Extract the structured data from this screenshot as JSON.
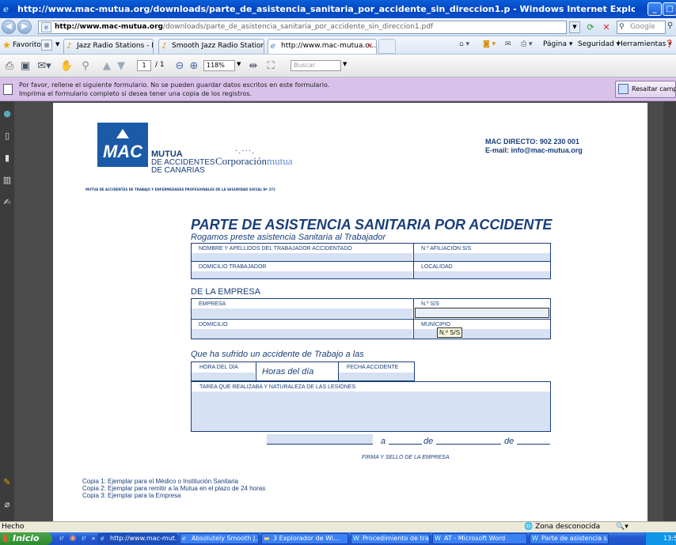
{
  "window": {
    "title": "http://www.mac-mutua.org/downloads/parte_de_asistencia_sanitaria_por_accidente_sin_direccion1.p - Windows Internet Explorer"
  },
  "nav": {
    "address_domain": "http://www.mac-mutua.org",
    "address_path": "/downloads/parte_de_asistencia_sanitaria_por_accidente_sin_direccion1.pdf",
    "search_placeholder": "Google"
  },
  "favorites": {
    "label": "Favoritos",
    "tabs": [
      {
        "label": "Jazz Radio Stations - Free In..."
      },
      {
        "label": "Smooth Jazz Radio Stations -..."
      },
      {
        "label": "http://www.mac-mutua.o..."
      }
    ],
    "commands": {
      "page": "Página",
      "security": "Seguridad",
      "tools": "Herramientas"
    }
  },
  "pdf_toolbar": {
    "page_current": "1",
    "page_total": "/ 1",
    "zoom": "118%",
    "search_placeholder": "Buscar"
  },
  "form_notice": {
    "line1": "Por favor, rellene el siguiente formulario. No se pueden guardar datos escritos en este formulario.",
    "line2": "Imprima el formulario completo si desea tener una copia de los registros.",
    "highlight_button": "Resaltar campos"
  },
  "document": {
    "logo": {
      "mac": "MAC",
      "mutua": "MUTUA",
      "line2": "DE ACCIDENTES",
      "line3": "DE CANARIAS",
      "corp_a": "Corporación",
      "corp_b": "mutua",
      "subline": "MUTUA DE ACCIDENTES DE TRABAJO Y ENFERMEDADES PROFESIONALES DE LA SEGURIDAD SOCIAL Nº 272"
    },
    "contact": {
      "phone": "MAC DIRECTO: 902 230 001",
      "email": "E-mail: info@mac-mutua.org"
    },
    "title": "PARTE DE ASISTENCIA SANITARIA POR ACCIDENTE",
    "subtitle": "Rogamos preste asistencia Sanitaria al Trabajador",
    "worker_fields": {
      "name": "NOMBRE Y APELLIDOS DEL TRABAJADOR ACCIDENTADO",
      "affiliation": "N.º AFILIACIÓN S/S",
      "address": "DOMICILIO TRABAJADOR",
      "locality": "LOCALIDAD"
    },
    "company_section": "DE LA EMPRESA",
    "company_fields": {
      "company": "EMPRESA",
      "ss_number": "N.º S/S",
      "address": "DOMICILIO",
      "municipality": "MUNICIPIO"
    },
    "tooltip": "N.º S/S",
    "accident_section": "Que ha sufrido un accidente de Trabajo a las",
    "accident_fields": {
      "hour_label": "HORA DEL DÍA",
      "hours_text": "Horas del día",
      "date_label": "FECHA ACCIDENTE",
      "task": "TAREA QUE REALIZABA Y NATURALEZA DE LAS LESIONES"
    },
    "signature": {
      "a": "a",
      "de1": "de",
      "de2": "de",
      "caption": "FIRMA Y SELLO DE LA EMPRESA."
    },
    "copies": [
      "Copia 1: Ejemplar para el Médico o Institución Sanitaria",
      "Copia 2: Ejemplar para remitir a la Mutua en el plazo de 24 horas",
      "Copia 3: Ejemplar para la Empresa"
    ]
  },
  "status": {
    "text": "Hecho",
    "zone": "Zona desconocida"
  },
  "taskbar": {
    "start": "Inicio",
    "tasks": [
      {
        "label": "http://www.mac-mut..."
      },
      {
        "label": "Absolutely Smooth J..."
      },
      {
        "label": "3 Explorador de Wi..."
      },
      {
        "label": "Procedimiento de tra..."
      },
      {
        "label": "AT - Microsoft Word"
      },
      {
        "label": "Parte de asistencia s..."
      }
    ],
    "clock": "13:5"
  }
}
